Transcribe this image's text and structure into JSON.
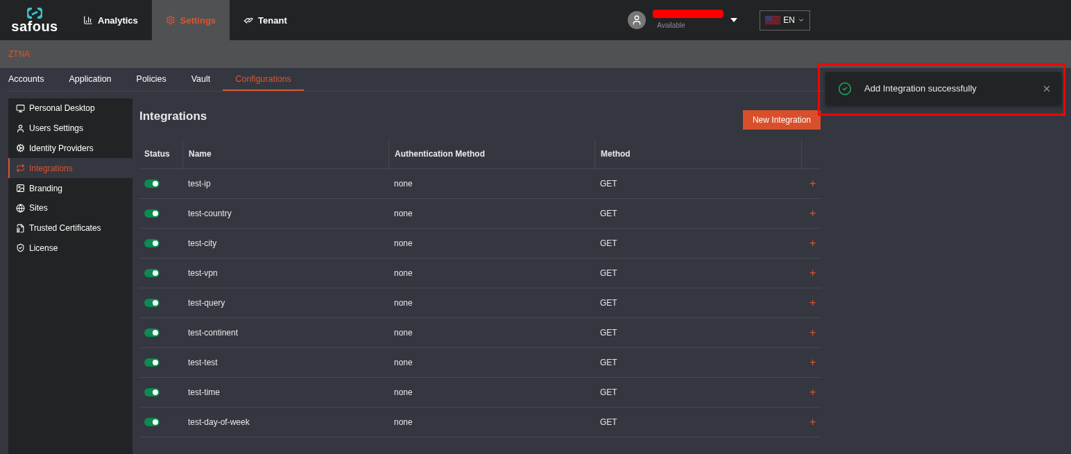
{
  "topbar": {
    "logo": "safous",
    "nav": [
      {
        "label": "Analytics",
        "selected": false
      },
      {
        "label": "Settings",
        "selected": true
      },
      {
        "label": "Tenant",
        "selected": false
      }
    ],
    "user": {
      "status": "Available"
    },
    "language": "EN"
  },
  "section": "ZTNA",
  "tabs": [
    {
      "label": "Accounts",
      "selected": false
    },
    {
      "label": "Application",
      "selected": false
    },
    {
      "label": "Policies",
      "selected": false
    },
    {
      "label": "Vault",
      "selected": false
    },
    {
      "label": "Configurations",
      "selected": true
    }
  ],
  "sidebar": {
    "items": [
      {
        "label": "Personal Desktop",
        "selected": false
      },
      {
        "label": "Users Settings",
        "selected": false
      },
      {
        "label": "Identity Providers",
        "selected": false
      },
      {
        "label": "Integrations",
        "selected": true
      },
      {
        "label": "Branding",
        "selected": false
      },
      {
        "label": "Sites",
        "selected": false
      },
      {
        "label": "Trusted Certificates",
        "selected": false
      },
      {
        "label": "License",
        "selected": false
      }
    ]
  },
  "page": {
    "title": "Integrations",
    "new_button": "New Integration"
  },
  "table": {
    "columns": [
      "Status",
      "Name",
      "Authentication Method",
      "Method"
    ],
    "rows": [
      {
        "on": true,
        "name": "test-ip",
        "auth": "none",
        "method": "GET",
        "action": "+"
      },
      {
        "on": true,
        "name": "test-country",
        "auth": "none",
        "method": "GET",
        "action": "+"
      },
      {
        "on": true,
        "name": "test-city",
        "auth": "none",
        "method": "GET",
        "action": "+"
      },
      {
        "on": true,
        "name": "test-vpn",
        "auth": "none",
        "method": "GET",
        "action": "+"
      },
      {
        "on": true,
        "name": "test-query",
        "auth": "none",
        "method": "GET",
        "action": "+"
      },
      {
        "on": true,
        "name": "test-continent",
        "auth": "none",
        "method": "GET",
        "action": "+"
      },
      {
        "on": true,
        "name": "test-test",
        "auth": "none",
        "method": "GET",
        "action": "+"
      },
      {
        "on": true,
        "name": "test-time",
        "auth": "none",
        "method": "GET",
        "action": "+"
      },
      {
        "on": true,
        "name": "test-day-of-week",
        "auth": "none",
        "method": "GET",
        "action": "+"
      }
    ]
  },
  "toast": {
    "message": "Add Integration successfully"
  }
}
